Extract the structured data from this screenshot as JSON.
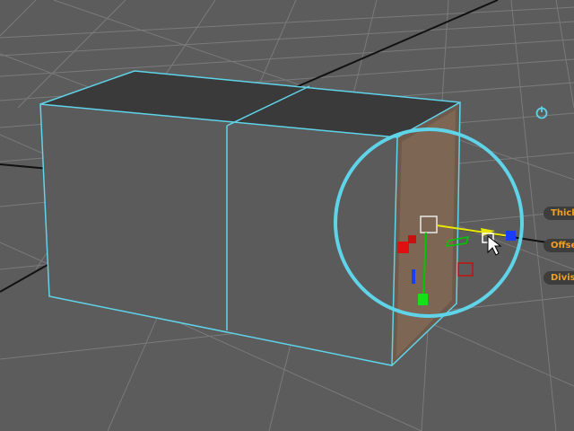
{
  "viewport": {
    "background": "#5c5c5c",
    "grid_color": "#7a7a7a",
    "axis_color": "#111111",
    "wireframe_color": "#5fd3e8",
    "face_color": "#5a5a5a",
    "top_face_color": "#3a3a3a",
    "selected_face_color": "#6d5a4c"
  },
  "manipulator": {
    "x_axis_color": "#e8e800",
    "y_axis_color": "#00c800",
    "z_axis_color": "#1a3cff",
    "handle_red": "#e01010",
    "cursor": "arrow-cursor-icon"
  },
  "hud": {
    "icon": "power-toggle-icon",
    "thickness_label": "Thick",
    "offset_label": "Offse",
    "divisions_label": "Divis"
  }
}
